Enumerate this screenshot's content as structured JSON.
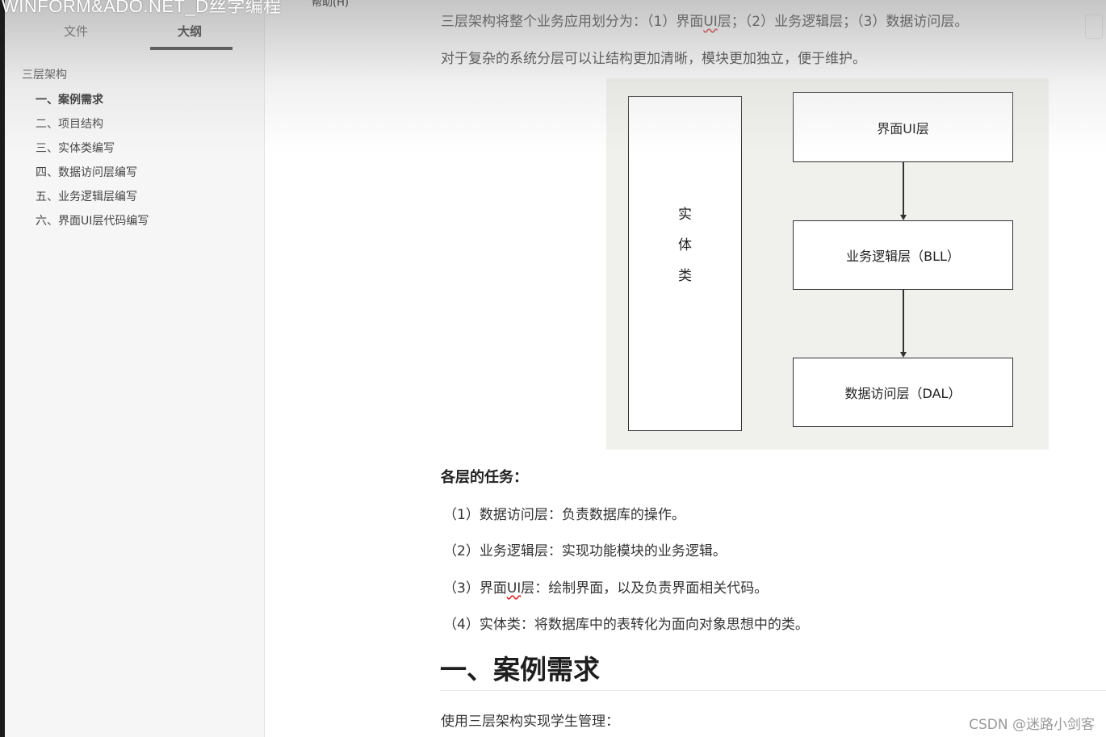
{
  "window": {
    "overlay_title": "WINFORM&ADO.NET_D丝学编程",
    "help_label": "帮助(H)"
  },
  "sidebar": {
    "tabs": [
      {
        "label": "文件"
      },
      {
        "label": "大纲"
      }
    ],
    "outline_root": "三层架构",
    "outline_items": [
      {
        "label": "一、案例需求"
      },
      {
        "label": "二、项目结构"
      },
      {
        "label": "三、实体类编写"
      },
      {
        "label": "四、数据访问层编写"
      },
      {
        "label": "五、业务逻辑层编写"
      },
      {
        "label": "六、界面UI层代码编写"
      }
    ]
  },
  "main": {
    "intro_line1_a": "三层架构将整个业务应用划分为：（1）界面",
    "intro_line1_ui": "UI",
    "intro_line1_b": "层；（2）业务逻辑层；（3）数据访问层。",
    "intro_line2": "对于复杂的系统分层可以让结构更加清晰，模块更加独立，便于维护。",
    "diagram": {
      "entity_chars": [
        "实",
        "体",
        "类"
      ],
      "ui_layer": "界面UI层",
      "bll_layer": "业务逻辑层（BLL）",
      "dal_layer": "数据访问层（DAL）"
    },
    "tasks_heading": "各层的任务：",
    "tasks": [
      {
        "text": "（1）数据访问层：负责数据库的操作。"
      },
      {
        "text_a": "（2）业务逻辑层：实现功能模块的业务逻辑。"
      },
      {
        "text_a": "（3）界面",
        "text_ui": "UI",
        "text_b": "层：绘制界面，以及负责界面相关代码。"
      },
      {
        "text": "（4）实体类：将数据库中的表转化为面向对象思想中的类。"
      }
    ],
    "section1_heading": "一、案例需求",
    "section1_para": "使用三层架构实现学生管理："
  },
  "watermark": "CSDN @迷路小剑客"
}
